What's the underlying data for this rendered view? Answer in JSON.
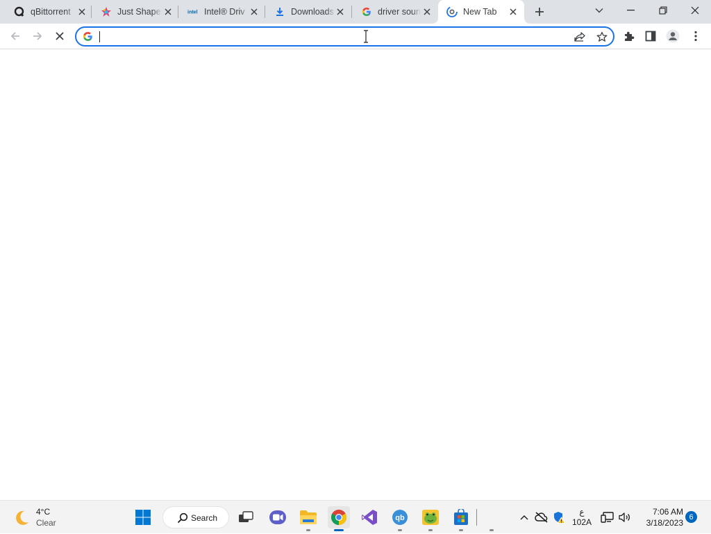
{
  "browser": {
    "tabs": [
      {
        "title": "qBittorrent",
        "icon": "qbittorrent-icon",
        "active": false
      },
      {
        "title": "Just Shapes",
        "icon": "just-shapes-icon",
        "active": false
      },
      {
        "title": "Intel® Driv",
        "icon": "intel-icon",
        "active": false
      },
      {
        "title": "Downloads",
        "icon": "download-icon",
        "active": false
      },
      {
        "title": "driver soun",
        "icon": "google-icon",
        "active": false
      },
      {
        "title": "New Tab",
        "icon": "chrome-newtab-icon",
        "active": true
      }
    ],
    "omnibox": {
      "value": "",
      "icon": "google-icon"
    },
    "loading": true
  },
  "taskbar": {
    "weather": {
      "temp": "4°C",
      "condition": "Clear",
      "icon": "moon-icon"
    },
    "search_label": "Search",
    "apps": [
      {
        "name": "start",
        "icon": "windows-icon"
      },
      {
        "name": "task-view",
        "icon": "task-view-icon"
      },
      {
        "name": "meet",
        "icon": "video-call-icon"
      },
      {
        "name": "file-explorer",
        "icon": "folder-icon",
        "running": true
      },
      {
        "name": "chrome",
        "icon": "chrome-icon",
        "running": true,
        "active": true
      },
      {
        "name": "visual-studio",
        "icon": "visual-studio-icon"
      },
      {
        "name": "qbittorrent",
        "icon": "qbittorrent-icon",
        "running": true
      },
      {
        "name": "game",
        "icon": "frog-game-icon",
        "running": true
      },
      {
        "name": "microsoft-store",
        "icon": "store-icon",
        "running": true
      }
    ],
    "tray": {
      "language_top": "ع",
      "language_bottom": "102A",
      "time": "7:06 AM",
      "date": "3/18/2023",
      "notifications": "6"
    }
  }
}
